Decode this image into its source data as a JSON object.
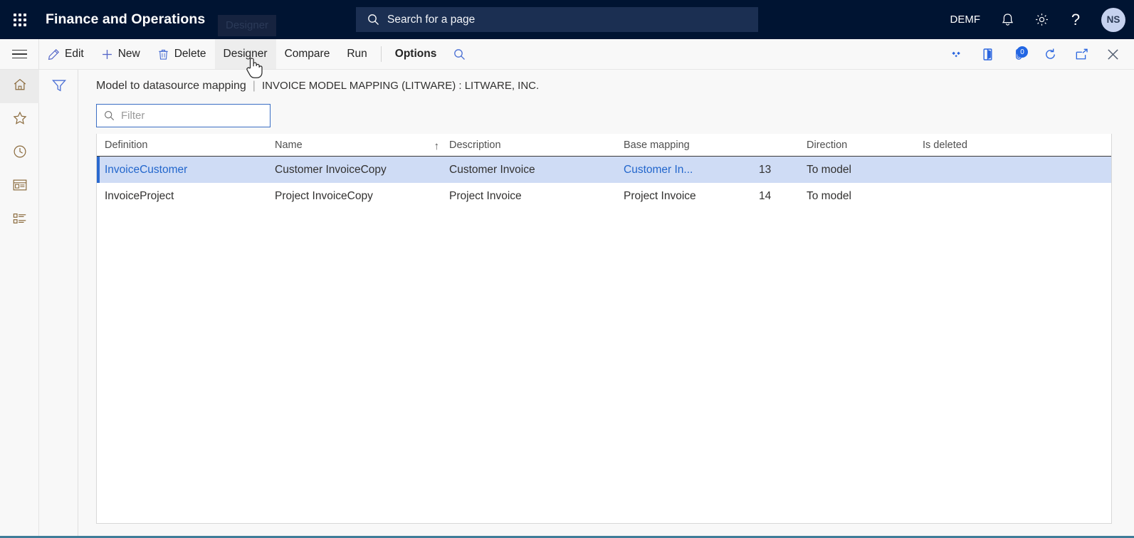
{
  "header": {
    "waffle_icon": "app-launcher-grid-icon",
    "app_title": "Finance and Operations",
    "search_placeholder": "Search for a page",
    "search_icon": "search-icon",
    "company": "DEMF",
    "notifications_icon": "bell-icon",
    "settings_icon": "gear-icon",
    "help_icon": "question-mark-icon",
    "avatar_initials": "NS",
    "bg_color": "#001432",
    "search_bg_color": "#1b2f52"
  },
  "tooltip": {
    "text": "Designer"
  },
  "toolbar": {
    "menu_icon": "hamburger-menu-icon",
    "buttons": [
      {
        "label": "Edit",
        "icon": "pencil-icon",
        "bold": false,
        "hovered": false
      },
      {
        "label": "New",
        "icon": "plus-icon",
        "bold": false,
        "hovered": false
      },
      {
        "label": "Delete",
        "icon": "trash-icon",
        "bold": false,
        "hovered": false
      },
      {
        "label": "Designer",
        "icon": "",
        "bold": false,
        "hovered": true
      },
      {
        "label": "Compare",
        "icon": "",
        "bold": false,
        "hovered": false
      },
      {
        "label": "Run",
        "icon": "",
        "bold": false,
        "hovered": false
      }
    ],
    "options_label": "Options",
    "search_icon": "search-icon",
    "right_icons": [
      {
        "name": "related-information-icon",
        "badge": ""
      },
      {
        "name": "office-app-icon",
        "badge": ""
      },
      {
        "name": "attachments-icon",
        "badge": "0"
      },
      {
        "name": "refresh-icon",
        "badge": ""
      },
      {
        "name": "open-in-new-window-icon",
        "badge": ""
      },
      {
        "name": "close-icon",
        "badge": ""
      }
    ],
    "accent_color": "#2266e3"
  },
  "navrail": {
    "items": [
      {
        "name": "home-icon",
        "active": true
      },
      {
        "name": "favorites-star-icon",
        "active": false
      },
      {
        "name": "recent-clock-icon",
        "active": false
      },
      {
        "name": "workspaces-icon",
        "active": false
      },
      {
        "name": "modules-list-icon",
        "active": false
      }
    ]
  },
  "filterpane": {
    "icon": "filter-funnel-icon"
  },
  "page": {
    "title": "Model to datasource mapping",
    "separator": "|",
    "context": "INVOICE MODEL MAPPING (LITWARE) : LITWARE, INC."
  },
  "filter": {
    "placeholder": "Filter",
    "value": "",
    "icon": "search-icon",
    "border_color": "#3b6ec4"
  },
  "grid": {
    "columns": [
      {
        "key": "definition",
        "label": "Definition",
        "sorted": ""
      },
      {
        "key": "name",
        "label": "Name",
        "sorted": "asc",
        "sort_glyph": "↑"
      },
      {
        "key": "description",
        "label": "Description",
        "sorted": ""
      },
      {
        "key": "base_mapping",
        "label": "Base mapping",
        "sorted": ""
      },
      {
        "key": "number",
        "label": "",
        "sorted": ""
      },
      {
        "key": "direction",
        "label": "Direction",
        "sorted": ""
      },
      {
        "key": "is_deleted",
        "label": "Is deleted",
        "sorted": ""
      }
    ],
    "rows": [
      {
        "definition": "InvoiceCustomer",
        "name": "Customer InvoiceCopy",
        "description": "Customer Invoice",
        "base_mapping": "Customer In...",
        "number": "13",
        "direction": "To model",
        "is_deleted": "",
        "selected": true,
        "definition_is_link": true,
        "base_mapping_is_link": true
      },
      {
        "definition": "InvoiceProject",
        "name": "Project InvoiceCopy",
        "description": "Project Invoice",
        "base_mapping": "Project Invoice",
        "number": "14",
        "direction": "To model",
        "is_deleted": "",
        "selected": false,
        "definition_is_link": false,
        "base_mapping_is_link": false
      }
    ],
    "selected_row_color": "#cfdcf5",
    "link_color": "#2266cc"
  }
}
